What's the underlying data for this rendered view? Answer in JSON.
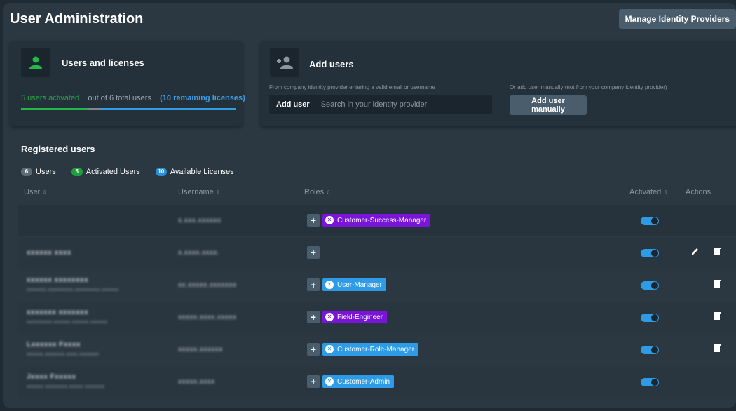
{
  "header": {
    "title": "User Administration",
    "manage_idp_label": "Manage Identity Providers"
  },
  "licenses_card": {
    "title": "Users and licenses",
    "activated_text": "5 users activated",
    "total_text": "out of 6 total users",
    "remaining_text": "(10 remaining licenses)",
    "activated_count": 5,
    "total_users": 6,
    "remaining_licenses": 10,
    "icon": "user-icon",
    "accent_color": "#22b84a"
  },
  "add_users_card": {
    "title": "Add users",
    "icon": "add-user-icon",
    "idp_hint": "From company identity provider entering a valid email or username",
    "manual_hint": "Or add user manually (not from your company identity provider)",
    "search_label": "Add user",
    "search_placeholder": "Search in your identity provider",
    "search_value": "",
    "manual_button_label": "Add user manually"
  },
  "registered": {
    "title": "Registered users",
    "stats": [
      {
        "count": "6",
        "label": "Users",
        "color": "#5e6b75"
      },
      {
        "count": "5",
        "label": "Activated Users",
        "color": "#1e9e3e"
      },
      {
        "count": "10",
        "label": "Available Licenses",
        "color": "#2a8ed9"
      }
    ],
    "columns": {
      "user": "User",
      "username": "Username",
      "roles": "Roles",
      "activated": "Activated",
      "actions": "Actions"
    },
    "sort_icon": "sort-icon",
    "rows": [
      {
        "name": "",
        "email": "",
        "username": "s.xxx.xxxxxx",
        "role": "Customer-Success-Manager",
        "role_color": "purple",
        "activated": true,
        "actions": []
      },
      {
        "name": "xxxxxx xxxx",
        "email": "",
        "username": "x.xxxx.xxxx.",
        "role": "",
        "role_color": "",
        "activated": true,
        "actions": [
          "edit",
          "delete"
        ]
      },
      {
        "name": "xxxxxx xxxxxxxx",
        "email": "xxxxxxx.xxxxxxxxx.xxxxxxxxx.xxxxxx",
        "username": "xx.xxxxx.xxxxxxx",
        "role": "User-Manager",
        "role_color": "blue",
        "activated": true,
        "actions": [
          "delete"
        ]
      },
      {
        "name": "xxxxxxx xxxxxxx",
        "email": "xxxxxxxxx.xxxxxx.xxxxxx.xxxxxx",
        "username": "xxxxx.xxxx.xxxxx",
        "role": "Field-Engineer",
        "role_color": "purple",
        "activated": true,
        "actions": [
          "delete"
        ]
      },
      {
        "name": "Lxxxxxx Fxxxx",
        "email": "xxxxxx.xxxxxxx.xxxx.xxxxxxx",
        "username": "xxxxx.xxxxxx",
        "role": "Customer-Role-Manager",
        "role_color": "blue",
        "activated": true,
        "actions": [
          "delete"
        ]
      },
      {
        "name": "Jxxxx Fxxxxx",
        "email": "xxxxxx.xxxxxxxx.xxxxx.xxxxxxx",
        "username": "xxxxx.xxxx",
        "role": "Customer-Admin",
        "role_color": "blue",
        "activated": true,
        "actions": []
      }
    ]
  }
}
